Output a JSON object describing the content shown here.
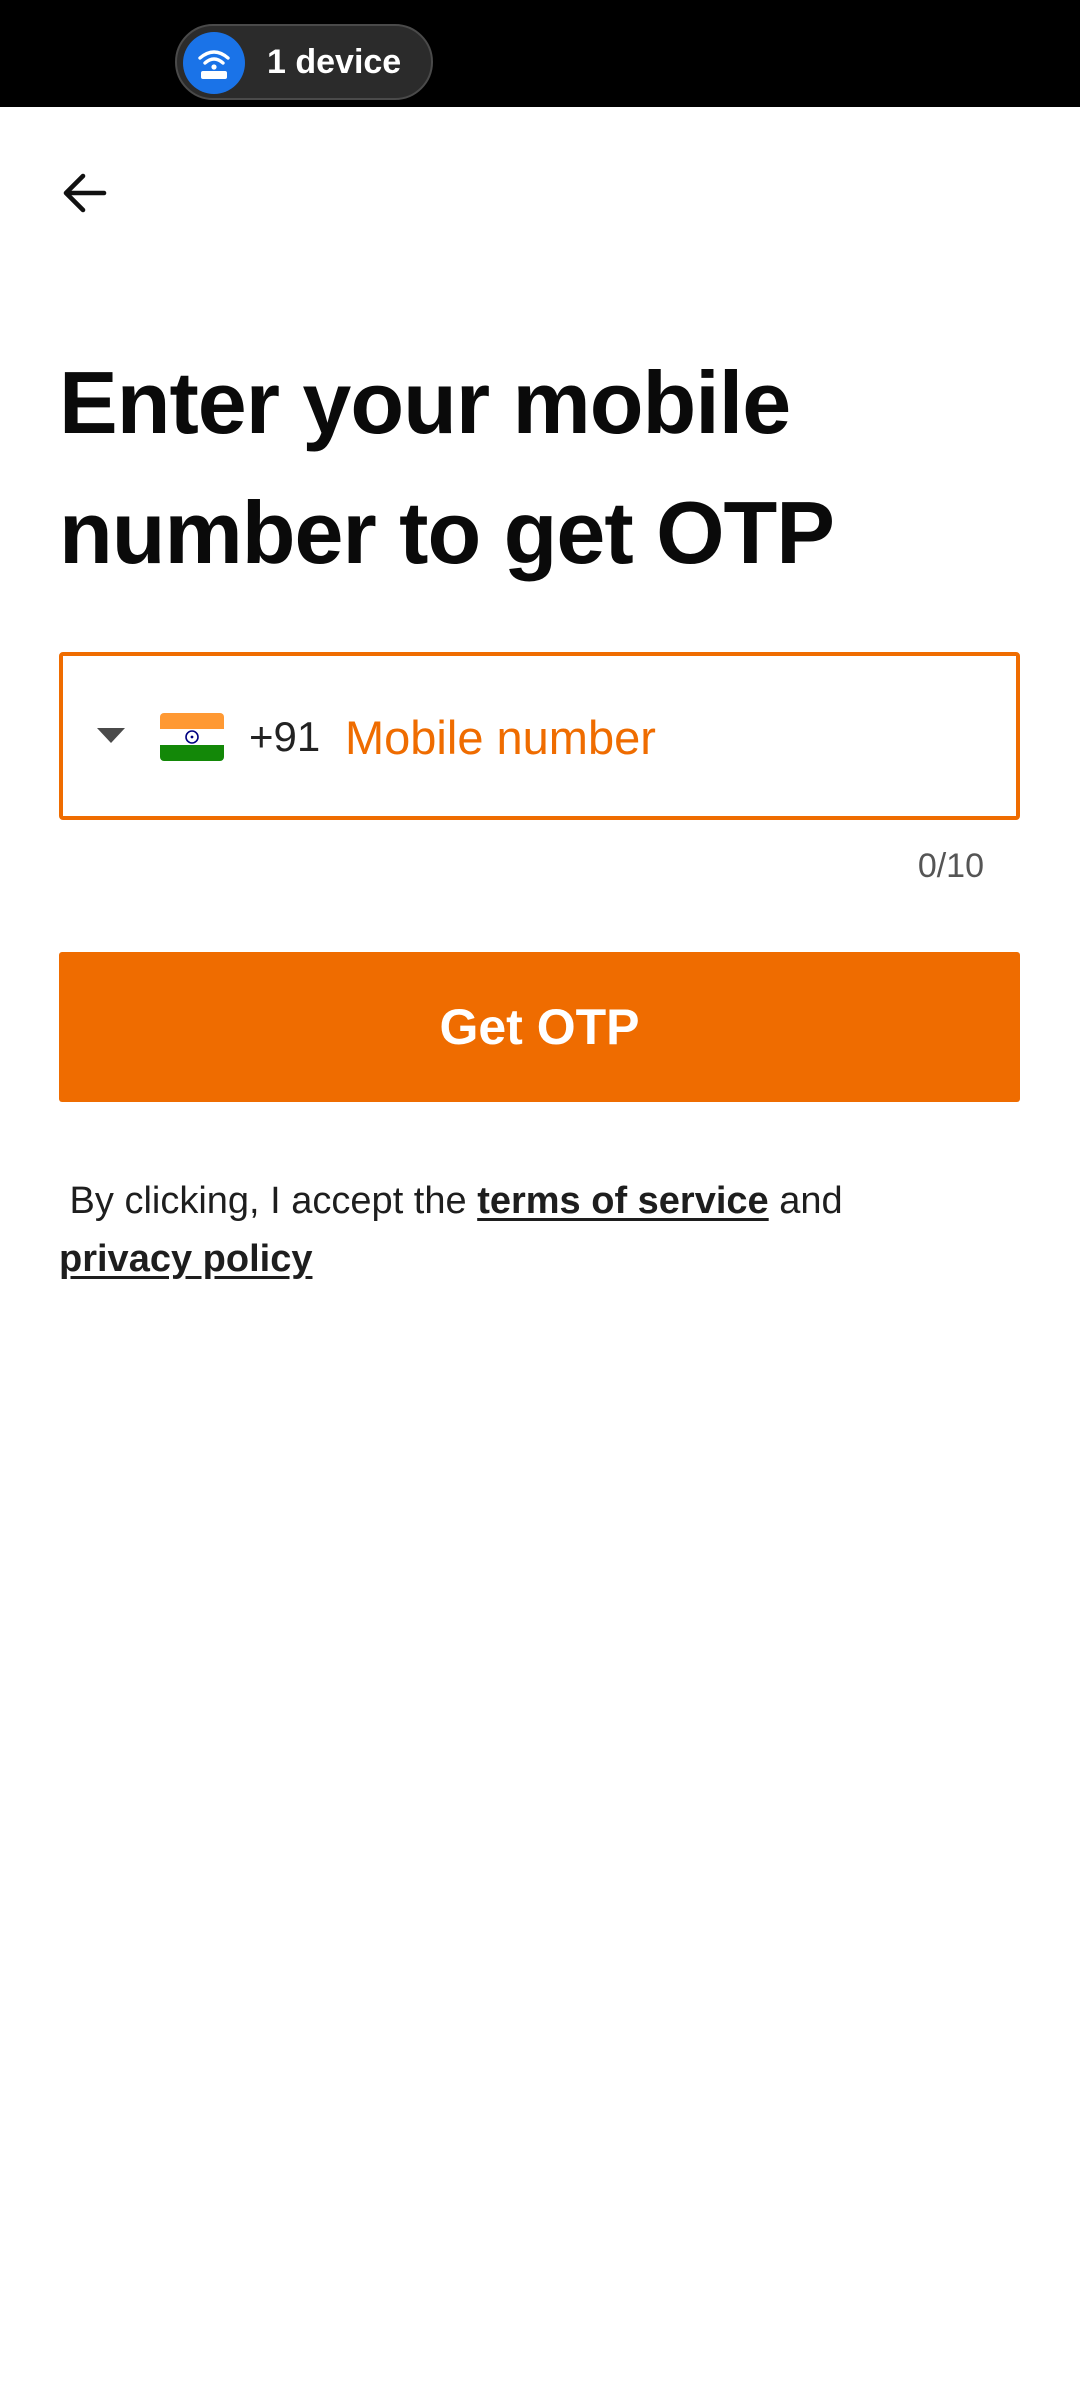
{
  "status_bar": {
    "device_pill_label": "1 device"
  },
  "header": {
    "back_icon": "arrow-left-icon"
  },
  "main": {
    "title": "Enter your mobile number to get OTP",
    "phone_input": {
      "country_flag": "india-flag-icon",
      "country_code": "+91",
      "placeholder": "Mobile number",
      "value": "",
      "counter": "0/10"
    },
    "submit_label": "Get OTP",
    "terms": {
      "prefix": " By clicking, I accept the ",
      "terms_link": "terms of service",
      "middle": " and ",
      "privacy_link": "privacy policy"
    }
  },
  "colors": {
    "accent": "#ef6c00",
    "status_bar": "#000000",
    "pill_icon": "#1a73e8"
  }
}
